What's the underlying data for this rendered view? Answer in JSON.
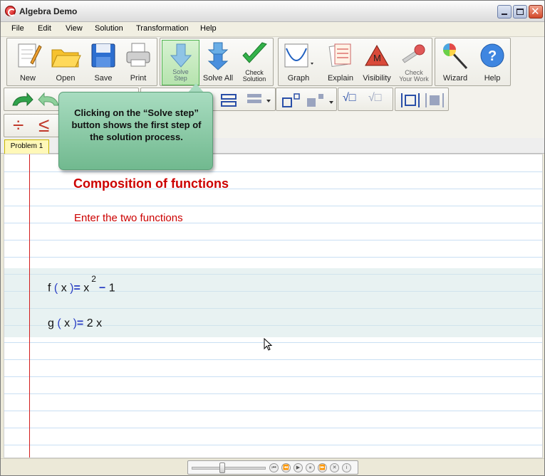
{
  "window": {
    "title": "Algebra Demo"
  },
  "menu": [
    "File",
    "Edit",
    "View",
    "Solution",
    "Transformation",
    "Help"
  ],
  "toolbar": {
    "new": "New",
    "open": "Open",
    "save": "Save",
    "print": "Print",
    "solve_step_1": "Solve",
    "solve_step_2": "Step",
    "solve_all": "Solve All",
    "check_solution_1": "Check",
    "check_solution_2": "Solution",
    "graph": "Graph",
    "explain": "Explain",
    "visibility": "Visibility",
    "check_work_1": "Check",
    "check_work_2": "Your Work",
    "wizard": "Wizard",
    "help": "Help"
  },
  "tabs": [
    "Problem 1"
  ],
  "tooltip": "Clicking on the “Solve step” button shows the first step of the solution process.",
  "worksheet": {
    "heading": "Composition of functions",
    "subheading": "Enter the two functions",
    "f": {
      "name": "f",
      "var": "x",
      "eq": "=",
      "base": "x",
      "exp": "2",
      "op": "−",
      "const": "1"
    },
    "g": {
      "name": "g",
      "var": "x",
      "eq": "=",
      "coef": "2",
      "x": "x"
    }
  },
  "symbols": {
    "divide": "÷",
    "leq": "≤",
    "sqrt1": "√□",
    "sqrt2": "√□"
  }
}
